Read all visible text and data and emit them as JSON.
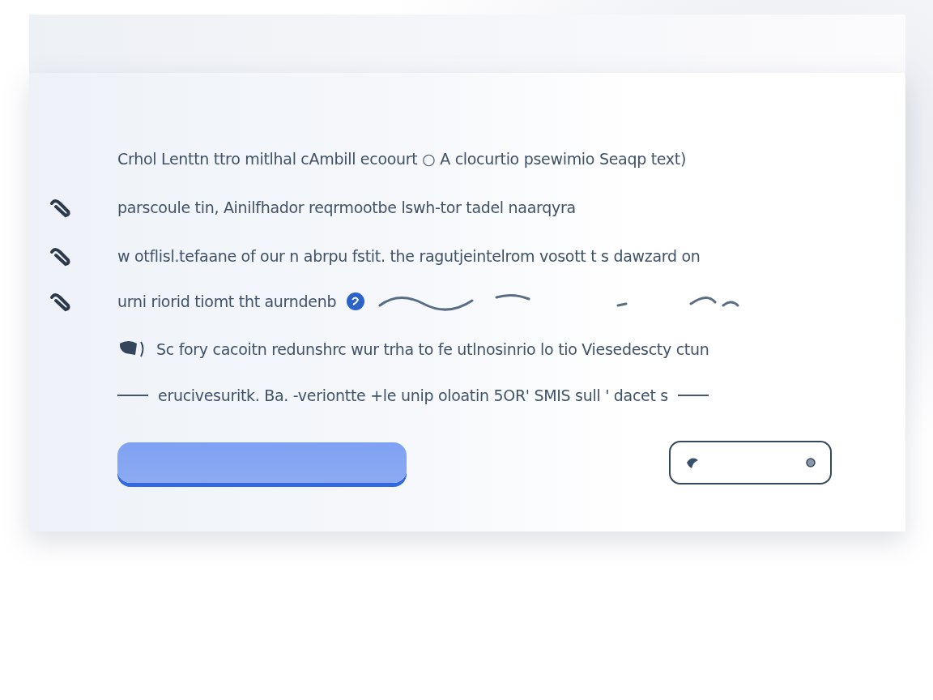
{
  "lines": [
    {
      "kind": "plain",
      "text": "Crhol Lenttn ttro mitlhal cAmbill ecoourt ○ A clocurtio psewimio Seaqp text)"
    },
    {
      "kind": "bulleted",
      "text": "parscoule tin, Ainilfhador reqrmootbe lswh-tor tadel naarqyra"
    },
    {
      "kind": "bulleted",
      "text": "w otflisl.tefaane of our n abrpu fstit. the ragutjeintelrom vosott t s dawzard on"
    },
    {
      "kind": "bulleted",
      "text": "urni riorid tiomt tht aurndenb"
    },
    {
      "kind": "note",
      "text": "Sc fory cacoitn redunshrc wur trha to fe utlnosinrio lo tio Viesedescty ctun"
    },
    {
      "kind": "rule",
      "text": "erucivesuritk. Ba. -veriontte +le unip oloatin 5OR' SMIS sull ' dacet s"
    }
  ]
}
